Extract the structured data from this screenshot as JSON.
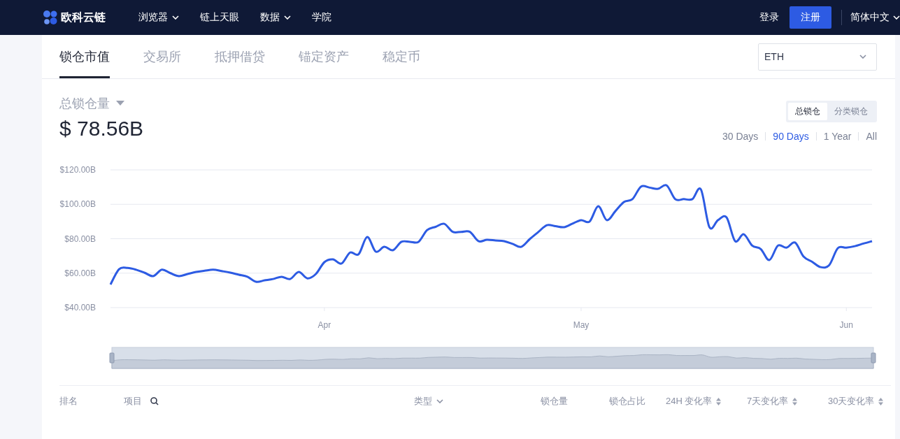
{
  "nav": {
    "logo": "欧科云链",
    "items": [
      {
        "label": "浏览器",
        "dropdown": true
      },
      {
        "label": "链上天眼",
        "dropdown": false
      },
      {
        "label": "数据",
        "dropdown": true
      },
      {
        "label": "学院",
        "dropdown": false
      }
    ],
    "login": "登录",
    "register": "注册",
    "language": "简体中文"
  },
  "tabs": [
    {
      "label": "锁仓市值",
      "selected": true
    },
    {
      "label": "交易所",
      "selected": false
    },
    {
      "label": "抵押借贷",
      "selected": false
    },
    {
      "label": "锚定资产",
      "selected": false
    },
    {
      "label": "稳定币",
      "selected": false
    }
  ],
  "chain_select": {
    "value": "ETH"
  },
  "metric": {
    "label": "总锁仓量",
    "value": "$ 78.56B"
  },
  "view_toggle": [
    {
      "label": "总锁仓",
      "selected": true
    },
    {
      "label": "分类锁仓",
      "selected": false
    }
  ],
  "ranges": [
    {
      "label": "30 Days",
      "selected": false
    },
    {
      "label": "90 Days",
      "selected": true
    },
    {
      "label": "1 Year",
      "selected": false
    },
    {
      "label": "All",
      "selected": false
    }
  ],
  "chart_data": {
    "type": "line",
    "categories": [
      null,
      null,
      null,
      null,
      null,
      null,
      null,
      null,
      null,
      null,
      null,
      null,
      null,
      null,
      null,
      null,
      null,
      null,
      null,
      null,
      null,
      null,
      null,
      null,
      null,
      "Apr",
      null,
      null,
      null,
      null,
      null,
      null,
      null,
      null,
      null,
      null,
      null,
      null,
      null,
      null,
      null,
      null,
      null,
      null,
      null,
      null,
      null,
      null,
      null,
      null,
      null,
      null,
      null,
      null,
      null,
      "May",
      null,
      null,
      null,
      null,
      null,
      null,
      null,
      null,
      null,
      null,
      null,
      null,
      null,
      null,
      null,
      null,
      null,
      null,
      null,
      null,
      null,
      null,
      null,
      null,
      null,
      null,
      null,
      null,
      null,
      null,
      "Jun",
      null,
      null,
      null
    ],
    "series": [
      {
        "color": "#2d5be3",
        "values": [
          53.4,
          62.3,
          63,
          62,
          60.2,
          58.3,
          62,
          60,
          58.3,
          59.5,
          60.7,
          61.4,
          62,
          61.2,
          60.3,
          59.1,
          57.9,
          55,
          55.8,
          56.6,
          57.9,
          56.6,
          60.7,
          57,
          59.5,
          66.4,
          68,
          65.6,
          72,
          71,
          81,
          72.5,
          75.3,
          73.3,
          78.2,
          78.2,
          78.2,
          85,
          86.9,
          88.7,
          84,
          84,
          84,
          78.6,
          79.4,
          79,
          78.6,
          77,
          75.3,
          79.8,
          83.9,
          87.9,
          87.3,
          86.7,
          88.8,
          90.8,
          90,
          98.9,
          90.8,
          96,
          101.3,
          103,
          110.3,
          109.7,
          109,
          111,
          103,
          103,
          103,
          108.6,
          86.7,
          90.8,
          92.4,
          78.6,
          82.6,
          76,
          74,
          67.6,
          76,
          74.8,
          77.8,
          69.6,
          66.6,
          63.5,
          64.7,
          74.5,
          74.8,
          75.7,
          77.2,
          78.6
        ]
      }
    ],
    "ylim": [
      40,
      120
    ],
    "grid": true,
    "yticks": [
      {
        "value": 40,
        "label": "$40.00B"
      },
      {
        "value": 60,
        "label": "$60.00B"
      },
      {
        "value": 80,
        "label": "$80.00B"
      },
      {
        "value": 100,
        "label": "$100.00B"
      },
      {
        "value": 120,
        "label": "$120.00B"
      }
    ]
  },
  "table": {
    "columns": [
      {
        "label": "排名",
        "kind": "text"
      },
      {
        "label": "项目",
        "kind": "search"
      },
      {
        "label": "类型",
        "kind": "dropdown"
      },
      {
        "label": "锁仓量",
        "kind": "text"
      },
      {
        "label": "锁仓占比",
        "kind": "text"
      },
      {
        "label": "24H 变化率",
        "kind": "sortable"
      },
      {
        "label": "7天变化率",
        "kind": "sortable"
      },
      {
        "label": "30天变化率",
        "kind": "sortable"
      }
    ]
  }
}
